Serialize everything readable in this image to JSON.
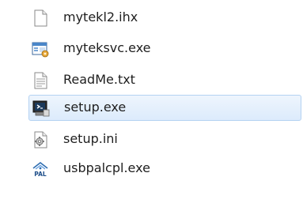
{
  "file_list": {
    "items": [
      {
        "name": "mytekl2.ihx",
        "icon": "generic-file-icon",
        "selected": false
      },
      {
        "name": "myteksvc.exe",
        "icon": "application-window-icon",
        "selected": false
      },
      {
        "name": "ReadMe.txt",
        "icon": "text-document-icon",
        "selected": false
      },
      {
        "name": "setup.exe",
        "icon": "setup-installer-icon",
        "selected": true
      },
      {
        "name": "setup.ini",
        "icon": "config-settings-icon",
        "selected": false
      },
      {
        "name": "usbpalcpl.exe",
        "icon": "pal-application-icon",
        "selected": false
      }
    ],
    "selection_colors": {
      "background": "#dcebfc",
      "border": "#b4d2f2"
    }
  }
}
